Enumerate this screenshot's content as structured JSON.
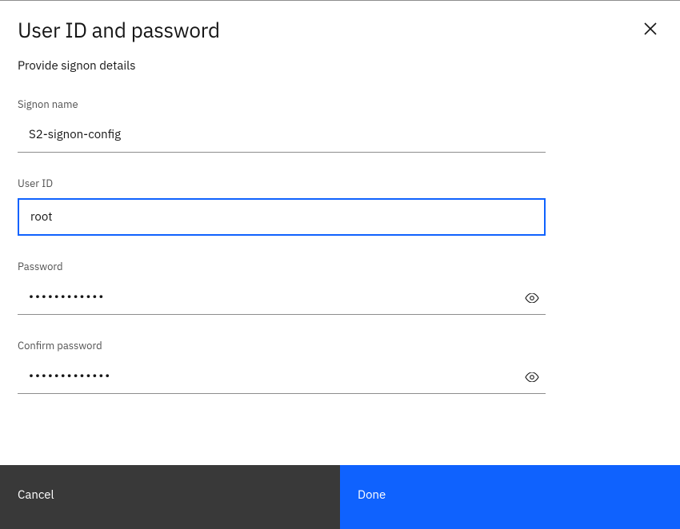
{
  "header": {
    "title": "User ID and password",
    "subtitle": "Provide signon details"
  },
  "fields": {
    "signon_name": {
      "label": "Signon name",
      "value": "S2-signon-config"
    },
    "user_id": {
      "label": "User ID",
      "value": "root"
    },
    "password": {
      "label": "Password",
      "value": "••••••••••••"
    },
    "confirm_password": {
      "label": "Confirm password",
      "value": "•••••••••••••"
    }
  },
  "footer": {
    "cancel_label": "Cancel",
    "done_label": "Done"
  }
}
